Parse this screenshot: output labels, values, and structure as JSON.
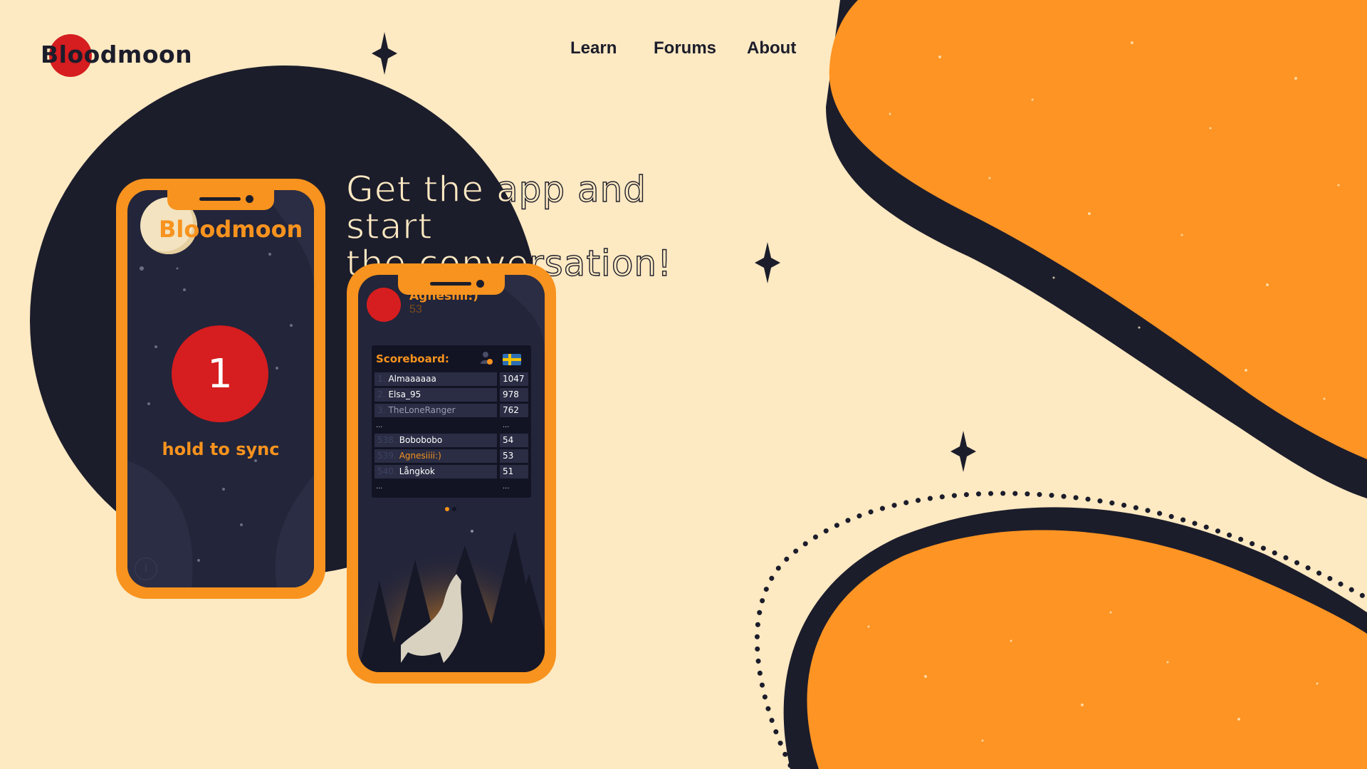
{
  "brand": {
    "name": "Bloodmoon"
  },
  "nav": {
    "items": [
      "Learn",
      "Forums",
      "About"
    ]
  },
  "hero": {
    "headline_line1": "Get the app and start",
    "headline_line2": "the conversation!"
  },
  "phone_sync": {
    "app_title": "Bloodmoon",
    "sync_count": "1",
    "sync_label": "hold to sync",
    "info_glyph": "i"
  },
  "phone_scoreboard": {
    "username": "Agnesiiii:)",
    "user_score": "53",
    "scoreboard_title": "Scoreboard:",
    "ellipsis": "...",
    "top_rows": [
      {
        "rank": "1.",
        "name": "Almaaaaaa",
        "score": "1047"
      },
      {
        "rank": "2.",
        "name": "Elsa_95",
        "score": "978"
      },
      {
        "rank": "3.",
        "name": "TheLoneRanger",
        "score": "762"
      }
    ],
    "near_rows": [
      {
        "rank": "538.",
        "name": "Bobobobo",
        "score": "54"
      },
      {
        "rank": "539.",
        "name": "Agnesiiii:)",
        "score": "53"
      },
      {
        "rank": "540.",
        "name": "Långkok",
        "score": "51"
      }
    ]
  },
  "colors": {
    "background": "#fde9c2",
    "navy": "#1c1d2b",
    "orange": "#f7931e",
    "red": "#d61d1f"
  },
  "icons": [
    "sparkle-star-icon",
    "info-icon",
    "person-icon",
    "sweden-flag-icon",
    "wolf-illustration"
  ]
}
